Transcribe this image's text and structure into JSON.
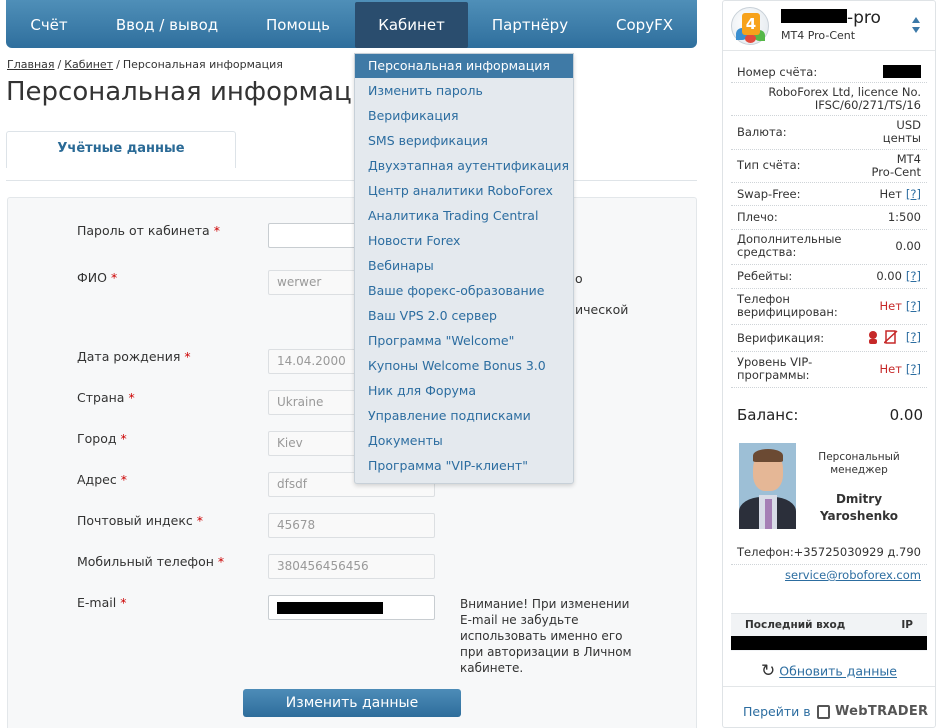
{
  "nav": {
    "items": [
      {
        "label": "Счёт"
      },
      {
        "label": "Ввод / вывод"
      },
      {
        "label": "Помощь"
      },
      {
        "label": "Кабинет"
      },
      {
        "label": "Партнёру"
      },
      {
        "label": "CopyFX"
      }
    ],
    "active": "Кабинет"
  },
  "breadcrumb": {
    "home": "Главная",
    "cabinet": "Кабинет",
    "current": "Персональная информация",
    "separator": "/"
  },
  "page_title": "Персональная информация",
  "tabs": {
    "account_data": "Учётные данные"
  },
  "dropdown": {
    "items": [
      "Персональная информация",
      "Изменить пароль",
      "Верификация",
      "SMS верификация",
      "Двухэтапная аутентификация",
      "Центр аналитики RoboForex",
      "Аналитика Trading Central",
      "Новости Forex",
      "Вебинары",
      "Ваше форекс-образование",
      "Ваш VPS 2.0 сервер",
      "Программа \"Welcome\"",
      "Купоны Welcome Bonus 3.0",
      "Ник для Форума",
      "Управление подписками",
      "Документы",
      "Программа \"VIP-клиент\""
    ]
  },
  "form": {
    "required_mark": "*",
    "password": {
      "label": "Пароль от кабинета",
      "value": ""
    },
    "fio": {
      "label": "ФИО",
      "value": "werwer"
    },
    "birth_date": {
      "label": "Дата рождения",
      "value": "14.04.2000"
    },
    "country": {
      "label": "Страна",
      "value": "Ukraine"
    },
    "city": {
      "label": "Город",
      "value": "Kiev"
    },
    "address": {
      "label": "Адрес",
      "value": "dfsdf"
    },
    "postal": {
      "label": "Почтовый индекс",
      "value": "45678"
    },
    "mobile": {
      "label": "Мобильный телефон",
      "value": "380456456456"
    },
    "email": {
      "label": "E-mail",
      "value": ""
    },
    "email_note": "Внимание! При изменении E-mail не забудьте использовать именно его при авторизации в Личном кабинете.",
    "side_fragments": {
      "frag1": "о",
      "frag2": "ической"
    },
    "submit_label": "Изменить данные"
  },
  "account": {
    "name_suffix": "-pro",
    "type_sub": "MT4 Pro-Cent",
    "logo_number": "4",
    "rows": {
      "account_number": {
        "label": "Номер счёта:",
        "value": ""
      },
      "company": {
        "value": "RoboForex Ltd, licence No. IFSC/60/271/TS/16"
      },
      "currency": {
        "label": "Валюта:",
        "value": "USD центы"
      },
      "account_type": {
        "label": "Тип счёта:",
        "value": "MT4 Pro-Cent"
      },
      "swap_free": {
        "label": "Swap-Free:",
        "value": "Нет"
      },
      "leverage": {
        "label": "Плечо:",
        "value": "1:500"
      },
      "additional_funds": {
        "label": "Дополнительные средства:",
        "value": "0.00"
      },
      "rebates": {
        "label": "Ребейты:",
        "value": "0.00"
      },
      "phone_verified": {
        "label": "Телефон верифицирован:",
        "value": "Нет"
      },
      "verification": {
        "label": "Верификация:"
      },
      "vip_level": {
        "label": "Уровень VIP-программы:",
        "value": "Нет"
      }
    },
    "help_link": "[?]",
    "balance_label": "Баланс:",
    "balance_value": "0.00",
    "manager": {
      "title": "Персональный менеджер",
      "name": "Dmitry Yaroshenko",
      "phone_label": "Телефон:",
      "phone": "+35725030929 д.790",
      "email": "service@roboforex.com"
    },
    "last_login": {
      "col1": "Последний вход",
      "col2": "IP"
    },
    "refresh_label": "Обновить данные",
    "goto_label": "Перейти в",
    "webtrader_label": "WebTRADER"
  },
  "colors": {
    "nav_bg": "#3a7cab",
    "nav_active": "#2a4d6e",
    "link": "#2c6da0",
    "required": "#cc0000",
    "negative": "#c62828",
    "dropdown_bg": "#e4e9ee"
  }
}
